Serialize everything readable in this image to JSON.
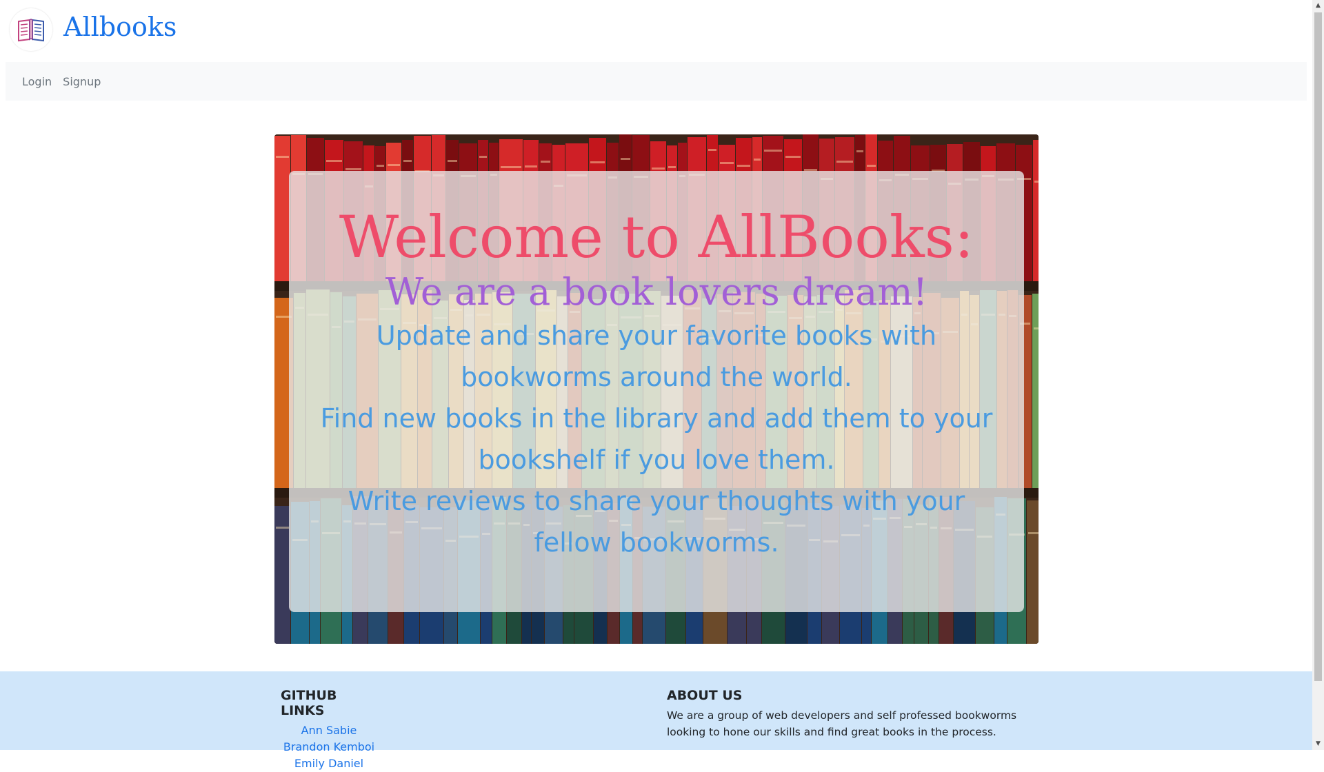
{
  "brand": {
    "name": "Allbooks",
    "logo_icon": "open-book-icon"
  },
  "nav": {
    "login": "Login",
    "signup": "Signup"
  },
  "hero": {
    "title": "Welcome to AllBooks:",
    "subtitle": "We are a book lovers dream!",
    "lines": [
      "Update and share your favorite books with bookworms around the world.",
      "Find new books in the library and add them to your bookshelf if you love them.",
      "Write reviews to share your thoughts with your fellow bookworms."
    ],
    "colors": {
      "title": "#ee4c6a",
      "subtitle": "#a25fd6",
      "lines": "#4a9be0"
    }
  },
  "footer": {
    "github_heading": "GITHUB LINKS",
    "github_links": [
      "Ann Sabie",
      "Brandon Kemboi",
      "Emily Daniel"
    ],
    "about_heading": "ABOUT US",
    "about_text": "We are a group of web developers and self professed bookworms looking to hone our skills and find great books in the process."
  },
  "colors": {
    "brand": "#1a73e8",
    "footer_bg": "#d0e6fa",
    "navbar_bg": "#f8f9fa"
  }
}
